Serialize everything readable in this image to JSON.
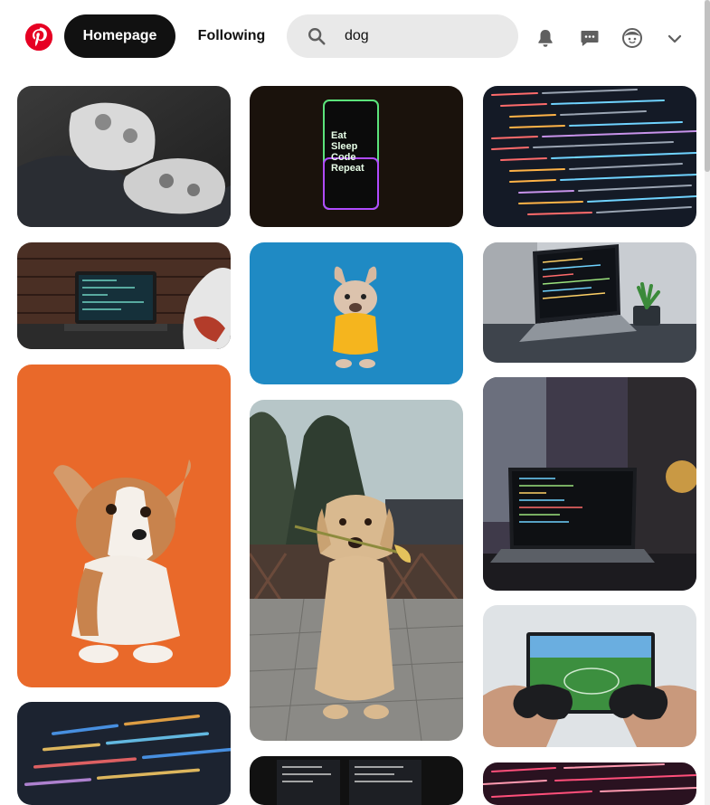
{
  "header": {
    "logo_icon": "pinterest-logo",
    "nav": {
      "home_label": "Homepage",
      "following_label": "Following"
    },
    "search": {
      "value": "dog",
      "icon": "search-icon"
    },
    "icons": [
      "bell-icon",
      "chat-icon",
      "avatar-icon",
      "chevron-down-icon"
    ],
    "brand_color": "#e60023"
  },
  "pins": [
    {
      "name": "pin-game-controllers",
      "subject": "game controllers"
    },
    {
      "name": "pin-phone-eat-sleep-code",
      "subject": "phone screen",
      "text_lines": [
        "Eat",
        "Sleep",
        "Code",
        "Repeat"
      ]
    },
    {
      "name": "pin-code-screen",
      "subject": "code on screen"
    },
    {
      "name": "pin-laptop-brick-wall",
      "subject": "laptop by brick wall"
    },
    {
      "name": "pin-french-bulldog",
      "subject": "french bulldog in yellow shirt"
    },
    {
      "name": "pin-laptop-desk-plant",
      "subject": "laptop on desk with plant"
    },
    {
      "name": "pin-corgi-puppy",
      "subject": "corgi puppy on orange"
    },
    {
      "name": "pin-golden-retriever-flower",
      "subject": "golden retriever holding flower"
    },
    {
      "name": "pin-laptop-lamp-window",
      "subject": "laptop near window with lamp"
    },
    {
      "name": "pin-code-blurred",
      "subject": "blurred code"
    },
    {
      "name": "pin-gaming-tv",
      "subject": "hands playing video game"
    },
    {
      "name": "pin-code-monitors",
      "subject": "code on monitors"
    },
    {
      "name": "pin-code-red",
      "subject": "red code"
    }
  ]
}
